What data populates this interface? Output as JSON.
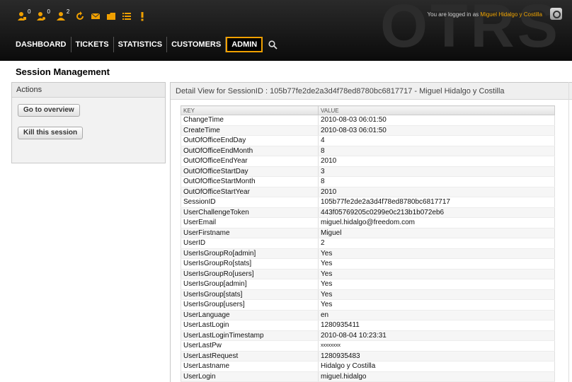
{
  "header": {
    "logo": "OTRS",
    "logged_in_prefix": "You are logged in as",
    "logged_in_user": "Miguel Hidalgo y Costilla"
  },
  "toolbar": {
    "items": [
      {
        "icon": "person-locked-icon",
        "count": "0"
      },
      {
        "icon": "person-watched-icon",
        "count": "0"
      },
      {
        "icon": "person-responsible-icon",
        "count": "2"
      },
      {
        "icon": "refresh-icon",
        "count": ""
      },
      {
        "icon": "envelope-icon",
        "count": ""
      },
      {
        "icon": "folder-icon",
        "count": ""
      },
      {
        "icon": "list-icon",
        "count": ""
      },
      {
        "icon": "exclamation-icon",
        "count": ""
      }
    ]
  },
  "nav": {
    "dashboard": "DASHBOARD",
    "tickets": "TICKETS",
    "statistics": "STATISTICS",
    "customers": "CUSTOMERS",
    "admin": "ADMIN"
  },
  "page": {
    "title": "Session Management"
  },
  "sidebar": {
    "header": "Actions",
    "go_overview": "Go to overview",
    "kill_session": "Kill this session"
  },
  "detail": {
    "header": "Detail View for SessionID : 105b77fe2de2a3d4f78ed8780bc6817717 - Miguel Hidalgo y Costilla",
    "columns": [
      "KEY",
      "VALUE"
    ],
    "rows": [
      {
        "key": "ChangeTime",
        "value": "2010-08-03 06:01:50"
      },
      {
        "key": "CreateTime",
        "value": "2010-08-03 06:01:50"
      },
      {
        "key": "OutOfOfficeEndDay",
        "value": "4"
      },
      {
        "key": "OutOfOfficeEndMonth",
        "value": "8"
      },
      {
        "key": "OutOfOfficeEndYear",
        "value": "2010"
      },
      {
        "key": "OutOfOfficeStartDay",
        "value": "3"
      },
      {
        "key": "OutOfOfficeStartMonth",
        "value": "8"
      },
      {
        "key": "OutOfOfficeStartYear",
        "value": "2010"
      },
      {
        "key": "SessionID",
        "value": "105b77fe2de2a3d4f78ed8780bc6817717"
      },
      {
        "key": "UserChallengeToken",
        "value": "443f05769205c0299e0c213b1b072eb6"
      },
      {
        "key": "UserEmail",
        "value": "miguel.hidalgo@freedom.com"
      },
      {
        "key": "UserFirstname",
        "value": "Miguel"
      },
      {
        "key": "UserID",
        "value": "2"
      },
      {
        "key": "UserIsGroupRo[admin]",
        "value": "Yes"
      },
      {
        "key": "UserIsGroupRo[stats]",
        "value": "Yes"
      },
      {
        "key": "UserIsGroupRo[users]",
        "value": "Yes"
      },
      {
        "key": "UserIsGroup[admin]",
        "value": "Yes"
      },
      {
        "key": "UserIsGroup[stats]",
        "value": "Yes"
      },
      {
        "key": "UserIsGroup[users]",
        "value": "Yes"
      },
      {
        "key": "UserLanguage",
        "value": "en"
      },
      {
        "key": "UserLastLogin",
        "value": "1280935411"
      },
      {
        "key": "UserLastLoginTimestamp",
        "value": "2010-08-04 10:23:31"
      },
      {
        "key": "UserLastPw",
        "value": "xxxxxxxx"
      },
      {
        "key": "UserLastRequest",
        "value": "1280935483"
      },
      {
        "key": "UserLastname",
        "value": "Hidalgo y Costilla"
      },
      {
        "key": "UserLogin",
        "value": "miguel.hidalgo"
      }
    ]
  },
  "colors": {
    "header_bg": "#111111",
    "accent": "#f0a000",
    "user_link": "#f0a400"
  }
}
